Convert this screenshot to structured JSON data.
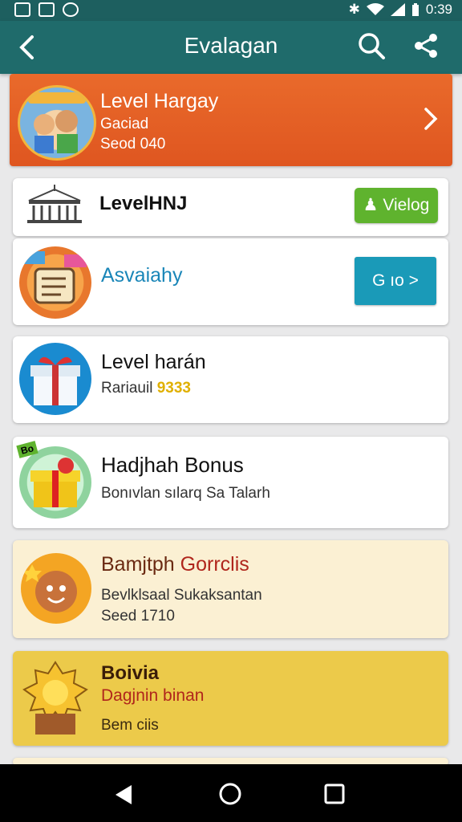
{
  "status": {
    "time": "0:39"
  },
  "appbar": {
    "title": "Evalagan",
    "back_icon": "arrow-left-icon",
    "search_icon": "search-icon",
    "share_icon": "share-icon"
  },
  "items": [
    {
      "title": "Level Hargay",
      "subtitle": "Gaciad",
      "detail": "Seod 040"
    },
    {
      "title": "LevelHNJ",
      "button": "Vielog"
    },
    {
      "title": "Asvaiahy",
      "button": "G ıo >"
    },
    {
      "title": "Level harán",
      "subtitle": "Rariauil",
      "coins": "9333"
    },
    {
      "title": "Hadjhah Bonus",
      "subtitle": "Bonıvlan sılarq Sa Talarh",
      "badge": "Bo"
    },
    {
      "title": "Bamjtph",
      "title_accent": "Gorrclis",
      "subtitle": "Bevlklsaal Sukaksantan",
      "detail": "Seed 1710"
    },
    {
      "title": "Boivia",
      "subtitle": "Dagjnin binan",
      "detail": "Bem ciis"
    }
  ],
  "colors": {
    "teal": "#1f6b6b",
    "orange": "#e96a2b",
    "green": "#5fb32e",
    "blue": "#1a9ab8",
    "gold": "#ecca4a",
    "cream": "#fbf0d3"
  }
}
